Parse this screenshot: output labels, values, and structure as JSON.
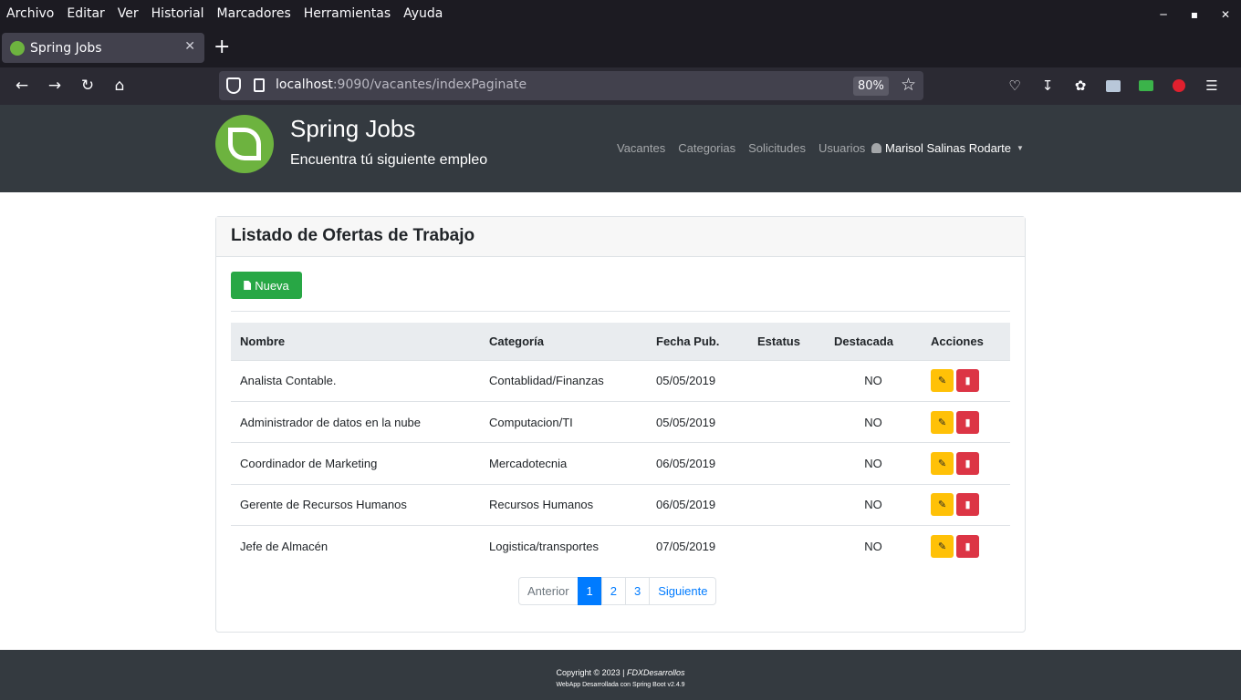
{
  "browser": {
    "menu": [
      {
        "label": "Archivo"
      },
      {
        "label": "Editar"
      },
      {
        "label": "Ver"
      },
      {
        "label": "Historial"
      },
      {
        "label": "Marcadores"
      },
      {
        "label": "Herramientas"
      },
      {
        "label": "Ayuda"
      }
    ],
    "tab_title": "Spring Jobs",
    "url_host": "localhost",
    "url_rest": ":9090/vacantes/indexPaginate",
    "zoom": "80%"
  },
  "site": {
    "brand_title": "Spring Jobs",
    "brand_subtitle": "Encuentra tú siguiente empleo",
    "nav": [
      "Vacantes",
      "Categorias",
      "Solicitudes",
      "Usuarios"
    ],
    "user": "Marisol Salinas Rodarte"
  },
  "card": {
    "title": "Listado de Ofertas de Trabajo",
    "new_button": "Nueva"
  },
  "table": {
    "headers": [
      "Nombre",
      "Categoría",
      "Fecha Pub.",
      "Estatus",
      "Destacada",
      "Acciones"
    ],
    "rows": [
      {
        "nombre": "Analista Contable.",
        "categoria": "Contablidad/Finanzas",
        "fecha": "05/05/2019",
        "estatus": "",
        "destacada": "NO"
      },
      {
        "nombre": "Administrador de datos en la nube",
        "categoria": "Computacion/TI",
        "fecha": "05/05/2019",
        "estatus": "",
        "destacada": "NO"
      },
      {
        "nombre": "Coordinador de Marketing",
        "categoria": "Mercadotecnia",
        "fecha": "06/05/2019",
        "estatus": "",
        "destacada": "NO"
      },
      {
        "nombre": "Gerente de Recursos Humanos",
        "categoria": "Recursos Humanos",
        "fecha": "06/05/2019",
        "estatus": "",
        "destacada": "NO"
      },
      {
        "nombre": "Jefe de Almacén",
        "categoria": "Logistica/transportes",
        "fecha": "07/05/2019",
        "estatus": "",
        "destacada": "NO"
      }
    ]
  },
  "pagination": {
    "prev": "Anterior",
    "pages": [
      "1",
      "2",
      "3"
    ],
    "current": "1",
    "next": "Siguiente"
  },
  "footer": {
    "copyright": "Copyright © 2023 |",
    "company": "FDXDesarrollos",
    "line2": "WebApp Desarrollada con Spring Boot v2.4.9"
  }
}
